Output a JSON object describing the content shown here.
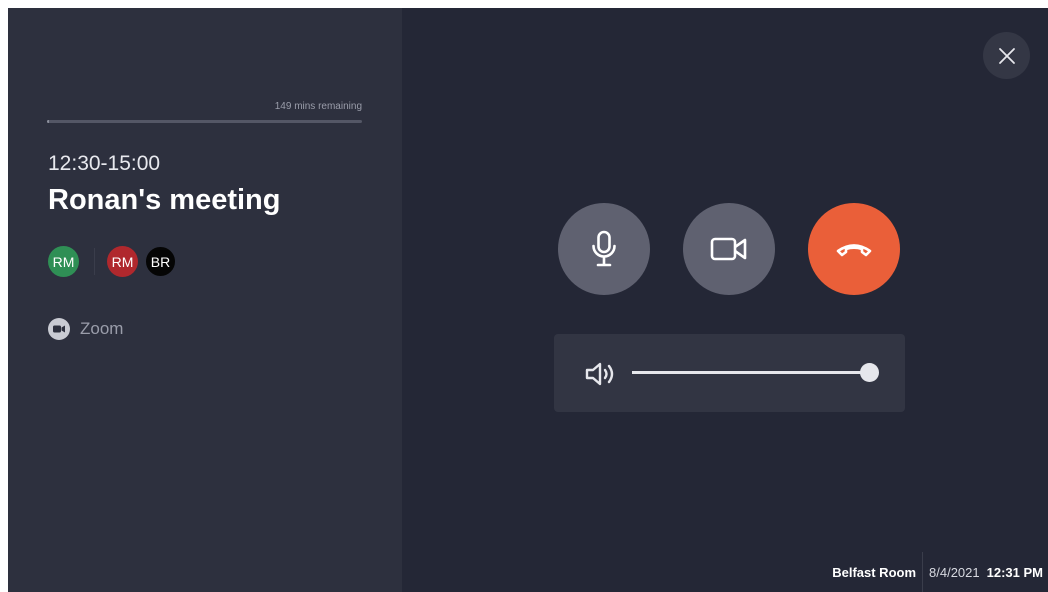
{
  "meeting": {
    "remaining": "149 mins remaining",
    "progress_fraction": 0.005,
    "time_range": "12:30-15:00",
    "title": "Ronan's meeting",
    "organizer_initials": "RM",
    "attendees": [
      {
        "initials": "RM",
        "color": "#b0282d"
      },
      {
        "initials": "BR",
        "color": "#050505"
      }
    ],
    "platform": "Zoom"
  },
  "controls": {
    "close_icon": "close-icon",
    "mic_icon": "microphone-icon",
    "camera_icon": "video-camera-icon",
    "hangup_icon": "hang-up-icon",
    "hangup_color": "#ea5f39",
    "volume_icon": "speaker-icon",
    "volume_fraction": 1.0
  },
  "status": {
    "room": "Belfast Room",
    "date": "8/4/2021",
    "time": "12:31 PM"
  },
  "colors": {
    "background": "#242736",
    "panel": "#2d303e",
    "organizer_avatar": "#2f8f55"
  }
}
